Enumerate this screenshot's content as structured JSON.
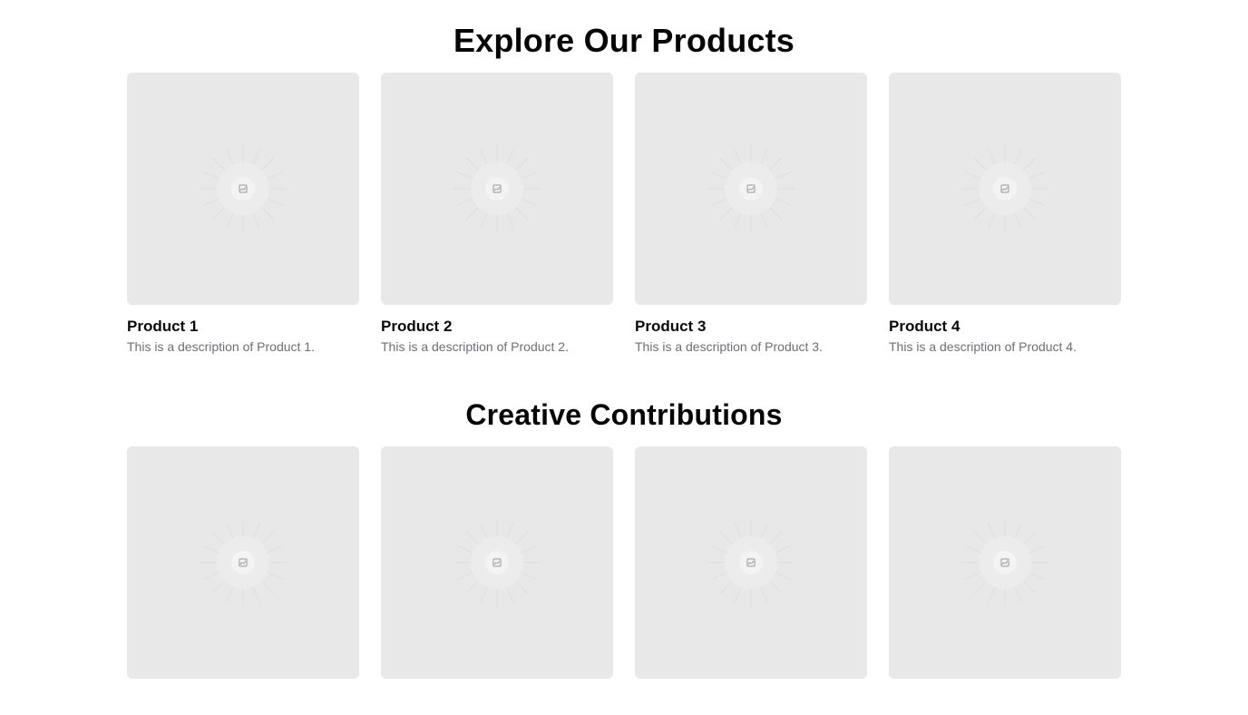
{
  "products_section": {
    "title": "Explore Our Products",
    "items": [
      {
        "name": "Product 1",
        "description": "This is a description of Product 1.",
        "icon": "image-placeholder-icon"
      },
      {
        "name": "Product 2",
        "description": "This is a description of Product 2.",
        "icon": "image-placeholder-icon"
      },
      {
        "name": "Product 3",
        "description": "This is a description of Product 3.",
        "icon": "image-placeholder-icon"
      },
      {
        "name": "Product 4",
        "description": "This is a description of Product 4.",
        "icon": "image-placeholder-icon"
      }
    ]
  },
  "contributions_section": {
    "title": "Creative Contributions",
    "items": [
      {
        "icon": "image-placeholder-icon"
      },
      {
        "icon": "image-placeholder-icon"
      },
      {
        "icon": "image-placeholder-icon"
      },
      {
        "icon": "image-placeholder-icon"
      }
    ]
  },
  "colors": {
    "placeholder_bg": "#e8e8e8",
    "heading": "#050505",
    "description": "#6b6f76"
  }
}
